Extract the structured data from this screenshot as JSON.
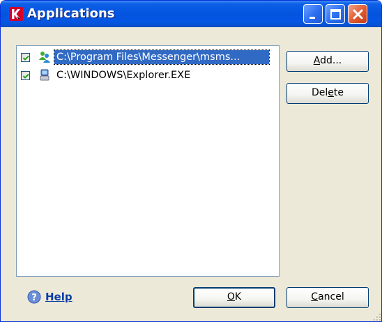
{
  "window": {
    "title": "Applications",
    "controls": [
      "minimize",
      "maximize",
      "close"
    ]
  },
  "applications": [
    {
      "checked": true,
      "path": "C:\\Program Files\\Messenger\\msms...",
      "icon": "messenger-icon",
      "selected": true
    },
    {
      "checked": true,
      "path": "C:\\WINDOWS\\Explorer.EXE",
      "icon": "explorer-icon",
      "selected": false
    }
  ],
  "buttons": {
    "add_prefix": "",
    "add_mnemonic": "A",
    "add_rest": "dd...",
    "delete_prefix": "Del",
    "delete_mnemonic": "e",
    "delete_rest": "te",
    "ok_prefix": "",
    "ok_mnemonic": "O",
    "ok_rest": "K",
    "cancel_prefix": "",
    "cancel_mnemonic": "C",
    "cancel_rest": "ancel"
  },
  "help": {
    "label": "Help"
  },
  "colors": {
    "titlebar": "#0454df",
    "selection": "#316ac5",
    "dialog": "#ece9d8",
    "close": "#e0592f"
  }
}
